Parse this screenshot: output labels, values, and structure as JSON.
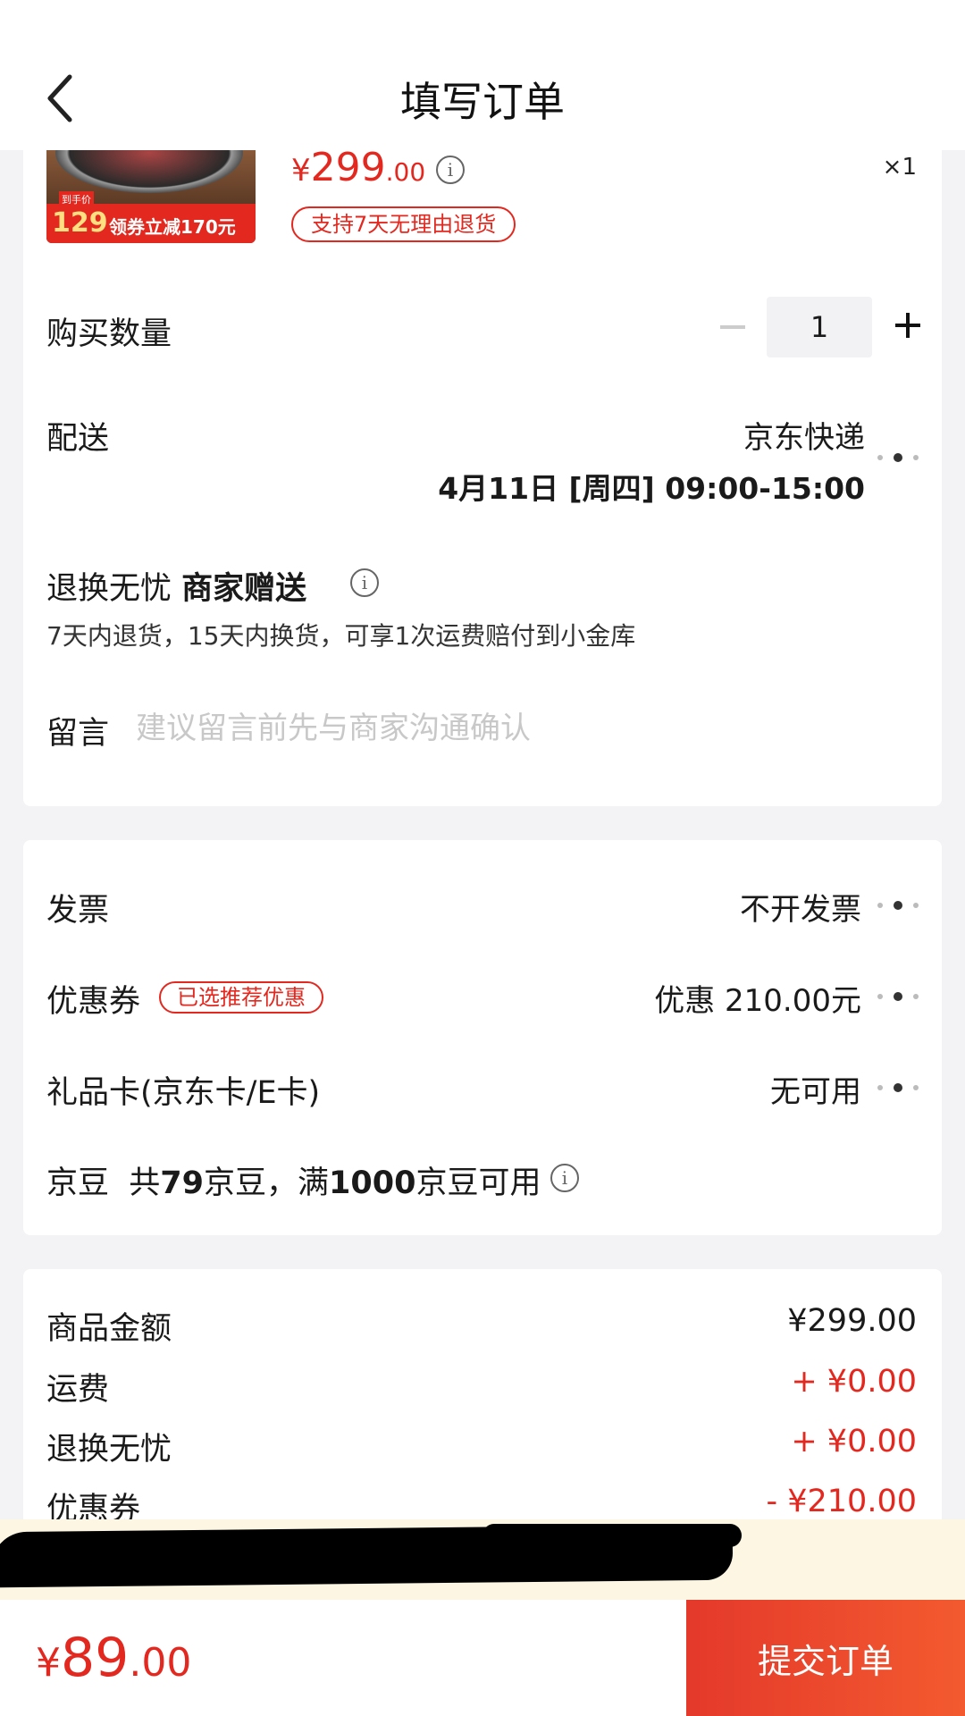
{
  "header": {
    "title": "填写订单"
  },
  "product": {
    "price_currency": "¥",
    "price_int": "299",
    "price_dec": ".00",
    "quantity_badge": "×1",
    "return_policy": "支持7天无理由退货",
    "thumb_tag": "到手价",
    "thumb_price": "129",
    "thumb_promo": "领券立减170元"
  },
  "quantity": {
    "label": "购买数量",
    "value": "1"
  },
  "delivery": {
    "label": "配送",
    "carrier": "京东快递",
    "time": "4月11日 [周四] 09:00-15:00"
  },
  "worry_free": {
    "label": "退换无忧",
    "gift": "商家赠送",
    "desc": "7天内退货，15天内换货，可享1次运费赔付到小金库"
  },
  "message": {
    "label": "留言",
    "placeholder": "建议留言前先与商家沟通确认"
  },
  "invoice": {
    "label": "发票",
    "value": "不开发票"
  },
  "coupon": {
    "label": "优惠券",
    "badge": "已选推荐优惠",
    "value": "优惠 210.00元"
  },
  "gift_card": {
    "label": "礼品卡(京东卡/E卡)",
    "value": "无可用"
  },
  "beans": {
    "label": "京豆",
    "pre": "共",
    "count": "79",
    "mid": "京豆，满",
    "threshold": "1000",
    "post": "京豆可用"
  },
  "summary": {
    "goods_label": "商品金额",
    "goods_value": "¥299.00",
    "shipping_label": "运费",
    "shipping_value": "+ ¥0.00",
    "worry_label": "退换无忧",
    "worry_value": "+ ¥0.00",
    "coupon_label": "优惠券",
    "coupon_value": "- ¥210.00"
  },
  "notice": {
    "text": ""
  },
  "bottom": {
    "total_currency": "¥",
    "total_int": "89",
    "total_dec": ".00",
    "submit_label": "提交订单"
  },
  "colors": {
    "accent": "#e3281f",
    "notice_bg": "#fcf6e2",
    "page_bg": "#f3f3f5"
  }
}
